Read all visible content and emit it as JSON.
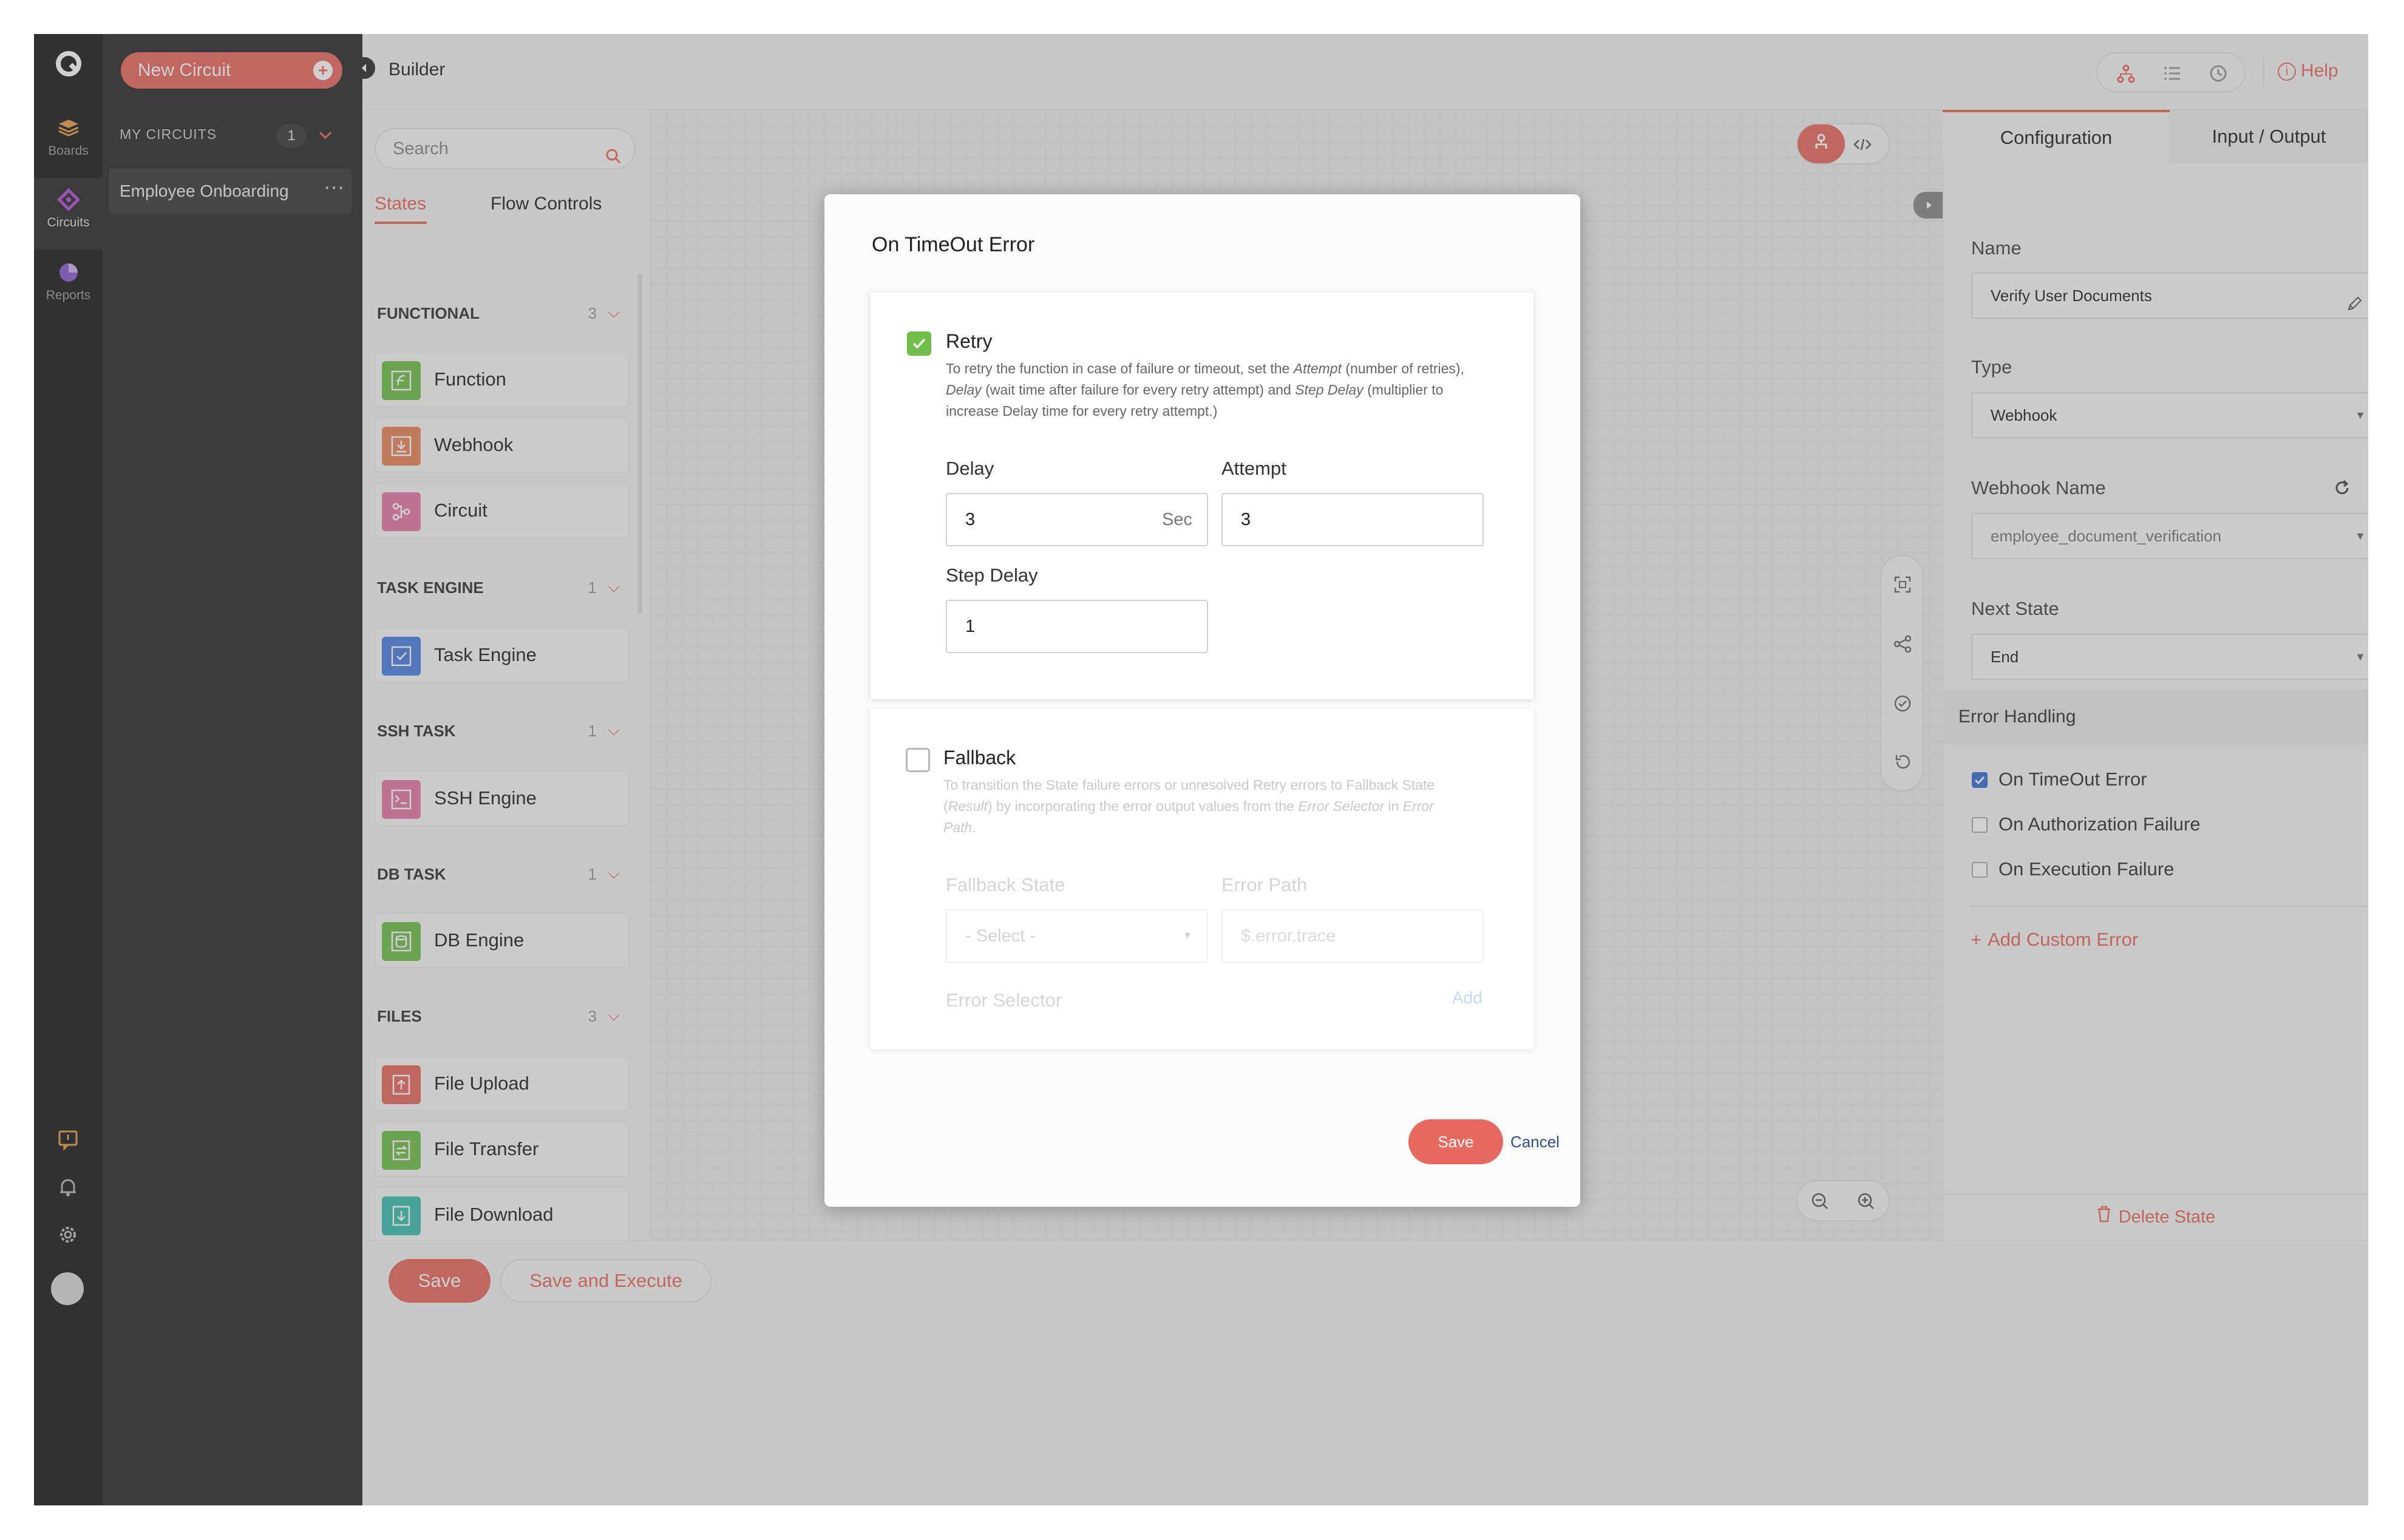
{
  "app": {
    "nav": [
      {
        "label": "Boards",
        "icon": "boards-icon"
      },
      {
        "label": "Circuits",
        "icon": "circuits-icon"
      },
      {
        "label": "Reports",
        "icon": "reports-icon"
      }
    ],
    "header_title": "Builder",
    "help_label": "Help"
  },
  "circuits_panel": {
    "new_circuit_label": "New Circuit",
    "section_label": "MY CIRCUITS",
    "count": "1",
    "items": [
      {
        "label": "Employee Onboarding"
      }
    ]
  },
  "states_panel": {
    "search_placeholder": "Search",
    "tabs": [
      "States",
      "Flow Controls"
    ],
    "sections": [
      {
        "title": "FUNCTIONAL",
        "count": "3",
        "items": [
          "Function",
          "Webhook",
          "Circuit"
        ]
      },
      {
        "title": "TASK ENGINE",
        "count": "1",
        "items": [
          "Task Engine"
        ]
      },
      {
        "title": "SSH TASK",
        "count": "1",
        "items": [
          "SSH Engine"
        ]
      },
      {
        "title": "DB TASK",
        "count": "1",
        "items": [
          "DB Engine"
        ]
      },
      {
        "title": "FILES",
        "count": "3",
        "items": [
          "File Upload",
          "File Transfer",
          "File Download"
        ]
      }
    ]
  },
  "bottom": {
    "save_label": "Save",
    "save_execute_label": "Save and Execute"
  },
  "modal": {
    "title": "On TimeOut Error",
    "retry": {
      "checked": true,
      "title": "Retry",
      "desc_1": "To retry the function in case of failure or timeout, set the ",
      "desc_attempt": "Attempt",
      "desc_2": " (number of retries), ",
      "desc_delay": "Delay",
      "desc_3": " (wait time after failure for every retry attempt) and ",
      "desc_stepdelay": "Step Delay",
      "desc_4": " (multiplier to increase Delay time for every retry attempt.)",
      "delay_label": "Delay",
      "delay_value": "3",
      "delay_unit": "Sec",
      "attempt_label": "Attempt",
      "attempt_value": "3",
      "step_delay_label": "Step Delay",
      "step_delay_value": "1"
    },
    "fallback": {
      "checked": false,
      "title": "Fallback",
      "desc_1": "To transition the State failure errors or unresolved Retry errors to Fallback State (",
      "desc_result": "Result",
      "desc_2": ") by incorporating the error output values from the ",
      "desc_errorselector": "Error Selector",
      "desc_3": " in ",
      "desc_errorpath": "Error Path",
      "desc_4": ".",
      "fallback_state_label": "Fallback State",
      "fallback_state_placeholder": "- Select -",
      "error_path_label": "Error Path",
      "error_path_placeholder": "$.error.trace",
      "error_selector_label": "Error Selector",
      "add_label": "Add"
    },
    "save_label": "Save",
    "cancel_label": "Cancel"
  },
  "config_panel": {
    "tabs": [
      "Configuration",
      "Input / Output"
    ],
    "name_label": "Name",
    "name_value": "Verify User Documents",
    "type_label": "Type",
    "type_value": "Webhook",
    "webhook_name_label": "Webhook Name",
    "webhook_name_value": "employee_document_verification",
    "next_state_label": "Next State",
    "next_state_value": "End",
    "error_handling_label": "Error Handling",
    "errors": [
      {
        "label": "On TimeOut Error",
        "checked": true
      },
      {
        "label": "On Authorization Failure",
        "checked": false
      },
      {
        "label": "On Execution Failure",
        "checked": false
      }
    ],
    "add_custom_error_label": "Add Custom Error",
    "delete_state_label": "Delete State"
  },
  "colors": {
    "accent": "#e8695f",
    "check_green": "#6fbf4a",
    "check_blue": "#3b6fd6",
    "sidebar": "#1c1c1c"
  }
}
